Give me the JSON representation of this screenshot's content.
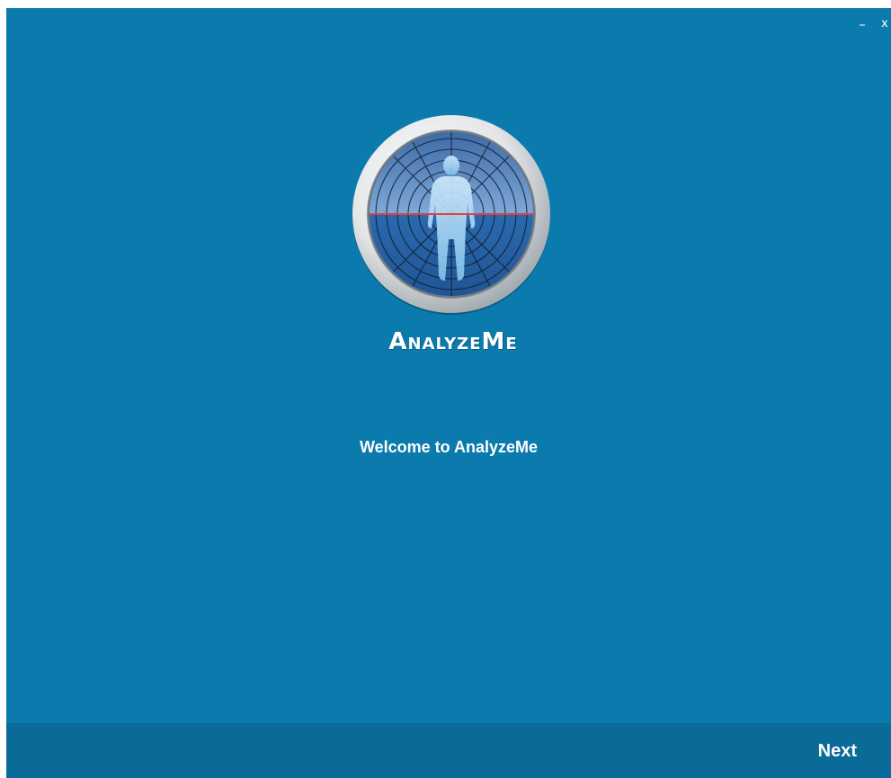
{
  "window": {
    "minimize_label": "–",
    "close_label": "x"
  },
  "logo": {
    "icon": "body-scan-radar-logo",
    "brand_text": "AnalyzeMe"
  },
  "main": {
    "welcome_text": "Welcome to AnalyzeMe"
  },
  "footer": {
    "next_label": "Next"
  },
  "colors": {
    "background": "#0b7bad",
    "footer": "#0a6a98",
    "text": "#ffffff",
    "scan_line": "#e04040"
  }
}
